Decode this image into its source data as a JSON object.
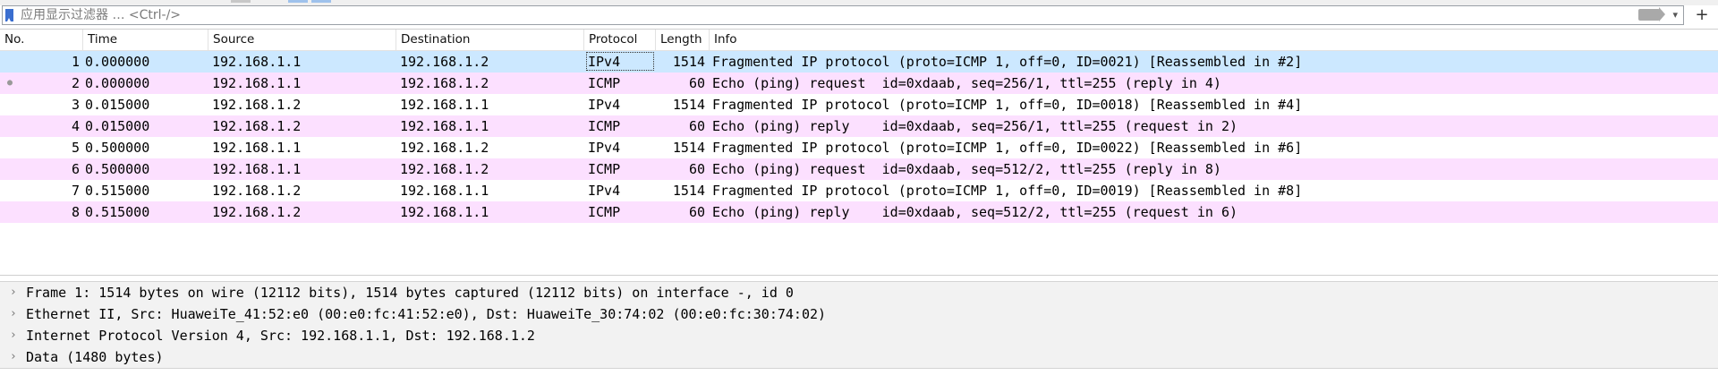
{
  "filter": {
    "placeholder": "应用显示过滤器 … <Ctrl-/>",
    "add_label": "+"
  },
  "columns": [
    "No.",
    "Time",
    "Source",
    "Destination",
    "Protocol",
    "Length",
    "Info"
  ],
  "packets": [
    {
      "no": "1",
      "time": "0.000000",
      "src": "192.168.1.1",
      "dst": "192.168.1.2",
      "proto": "IPv4",
      "len": "1514",
      "info": "Fragmented IP protocol (proto=ICMP 1, off=0, ID=0021) [Reassembled in #2]"
    },
    {
      "no": "2",
      "time": "0.000000",
      "src": "192.168.1.1",
      "dst": "192.168.1.2",
      "proto": "ICMP",
      "len": "60",
      "info": "Echo (ping) request  id=0xdaab, seq=256/1, ttl=255 (reply in 4)"
    },
    {
      "no": "3",
      "time": "0.015000",
      "src": "192.168.1.2",
      "dst": "192.168.1.1",
      "proto": "IPv4",
      "len": "1514",
      "info": "Fragmented IP protocol (proto=ICMP 1, off=0, ID=0018) [Reassembled in #4]"
    },
    {
      "no": "4",
      "time": "0.015000",
      "src": "192.168.1.2",
      "dst": "192.168.1.1",
      "proto": "ICMP",
      "len": "60",
      "info": "Echo (ping) reply    id=0xdaab, seq=256/1, ttl=255 (request in 2)"
    },
    {
      "no": "5",
      "time": "0.500000",
      "src": "192.168.1.1",
      "dst": "192.168.1.2",
      "proto": "IPv4",
      "len": "1514",
      "info": "Fragmented IP protocol (proto=ICMP 1, off=0, ID=0022) [Reassembled in #6]"
    },
    {
      "no": "6",
      "time": "0.500000",
      "src": "192.168.1.1",
      "dst": "192.168.1.2",
      "proto": "ICMP",
      "len": "60",
      "info": "Echo (ping) request  id=0xdaab, seq=512/2, ttl=255 (reply in 8)"
    },
    {
      "no": "7",
      "time": "0.515000",
      "src": "192.168.1.2",
      "dst": "192.168.1.1",
      "proto": "IPv4",
      "len": "1514",
      "info": "Fragmented IP protocol (proto=ICMP 1, off=0, ID=0019) [Reassembled in #8]"
    },
    {
      "no": "8",
      "time": "0.515000",
      "src": "192.168.1.2",
      "dst": "192.168.1.1",
      "proto": "ICMP",
      "len": "60",
      "info": "Echo (ping) reply    id=0xdaab, seq=512/2, ttl=255 (request in 6)"
    }
  ],
  "details": [
    "Frame 1: 1514 bytes on wire (12112 bits), 1514 bytes captured (12112 bits) on interface -, id 0",
    "Ethernet II, Src: HuaweiTe_41:52:e0 (00:e0:fc:41:52:e0), Dst: HuaweiTe_30:74:02 (00:e0:fc:30:74:02)",
    "Internet Protocol Version 4, Src: 192.168.1.1, Dst: 192.168.1.2",
    "Data (1480 bytes)"
  ],
  "icons": {
    "bookmark": "filter-bookmark-icon",
    "apply": "apply-arrow-icon",
    "expand": "chevron-right-icon",
    "related": "related-packet-dot-icon"
  },
  "colors": {
    "selected": "#cce8ff",
    "icmp": "#fce0ff",
    "ipv4": "#ffffff"
  }
}
